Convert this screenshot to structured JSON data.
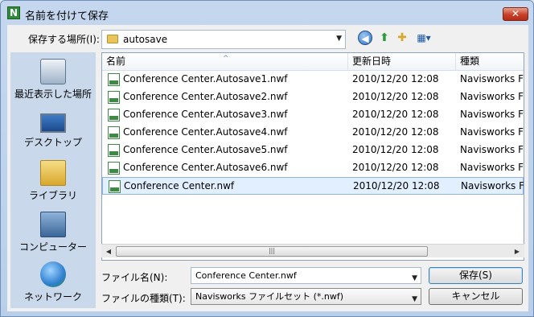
{
  "window": {
    "title": "名前を付けて保存",
    "app_icon": "N"
  },
  "location": {
    "label": "保存する場所(I):",
    "value": "autosave"
  },
  "places": [
    {
      "label": "最近表示した場所",
      "icon": "recent-places-icon"
    },
    {
      "label": "デスクトップ",
      "icon": "desktop-icon"
    },
    {
      "label": "ライブラリ",
      "icon": "library-icon"
    },
    {
      "label": "コンピューター",
      "icon": "computer-icon"
    },
    {
      "label": "ネットワーク",
      "icon": "network-icon"
    }
  ],
  "columns": {
    "name": "名前",
    "date": "更新日時",
    "type": "種類"
  },
  "files": [
    {
      "name": "Conference Center.Autosave1.nwf",
      "date": "2010/12/20 12:08",
      "type": "Navisworks F"
    },
    {
      "name": "Conference Center.Autosave2.nwf",
      "date": "2010/12/20 12:08",
      "type": "Navisworks F"
    },
    {
      "name": "Conference Center.Autosave3.nwf",
      "date": "2010/12/20 12:08",
      "type": "Navisworks F"
    },
    {
      "name": "Conference Center.Autosave4.nwf",
      "date": "2010/12/20 12:08",
      "type": "Navisworks F"
    },
    {
      "name": "Conference Center.Autosave5.nwf",
      "date": "2010/12/20 12:08",
      "type": "Navisworks F"
    },
    {
      "name": "Conference Center.Autosave6.nwf",
      "date": "2010/12/20 12:08",
      "type": "Navisworks F"
    },
    {
      "name": "Conference Center.nwf",
      "date": "2010/12/20 12:08",
      "type": "Navisworks F",
      "selected": true
    }
  ],
  "form": {
    "filename_label": "ファイル名(N):",
    "filename_value": "Conference Center.nwf",
    "filetype_label": "ファイルの種類(T):",
    "filetype_value": "Navisworks ファイルセット (*.nwf)"
  },
  "buttons": {
    "save": "保存(S)",
    "cancel": "キャンセル"
  },
  "icons": {
    "close": "✕",
    "back": "◀",
    "up": "⬆",
    "new_folder": "✚",
    "views": "▦▾",
    "scroll_left": "◀",
    "scroll_right": "▶",
    "grip": "|||",
    "sort": "^",
    "dropdown": "▼"
  }
}
